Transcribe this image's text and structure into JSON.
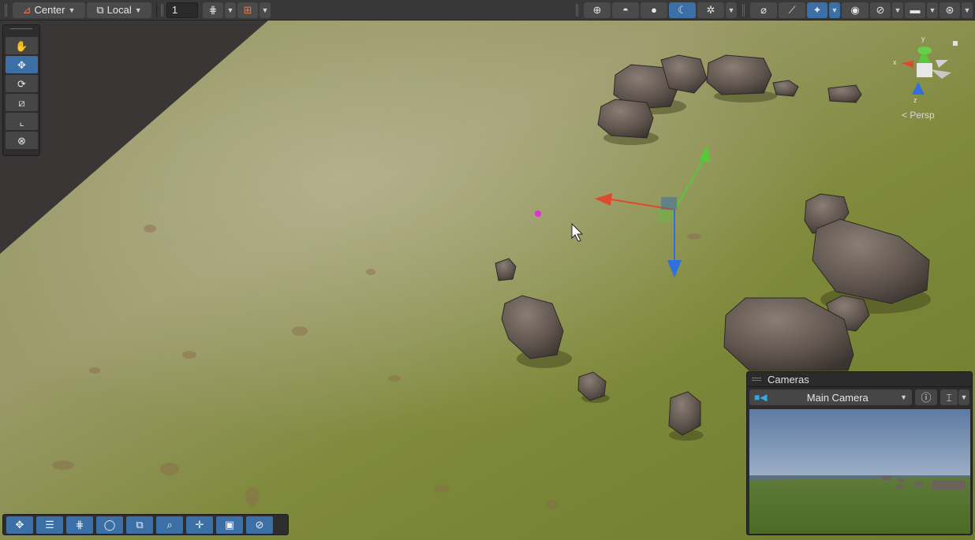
{
  "toolbar": {
    "pivot": "Center",
    "space": "Local",
    "grid_increment": "1"
  },
  "gizmo": {
    "projection": "< Persp",
    "axis_x": "x",
    "axis_y": "y",
    "axis_z": "z"
  },
  "cameras": {
    "title": "Cameras",
    "selected": "Main Camera"
  },
  "icons": {
    "pivot": "pivot-icon",
    "space": "local-space-icon",
    "grid": "grid-snap-icon",
    "increment": "increment-snap-icon",
    "draw_mode": "draw-mode-icon",
    "effects": "scene-effects-icon",
    "visibility": "visibility-icon",
    "camera": "scene-camera-icon",
    "gizmos": "gizmos-icon"
  },
  "colors": {
    "accent": "#3b6fa6",
    "axis_x": "#e04a2c",
    "axis_y": "#58c73c",
    "axis_z": "#2f6fe0"
  }
}
